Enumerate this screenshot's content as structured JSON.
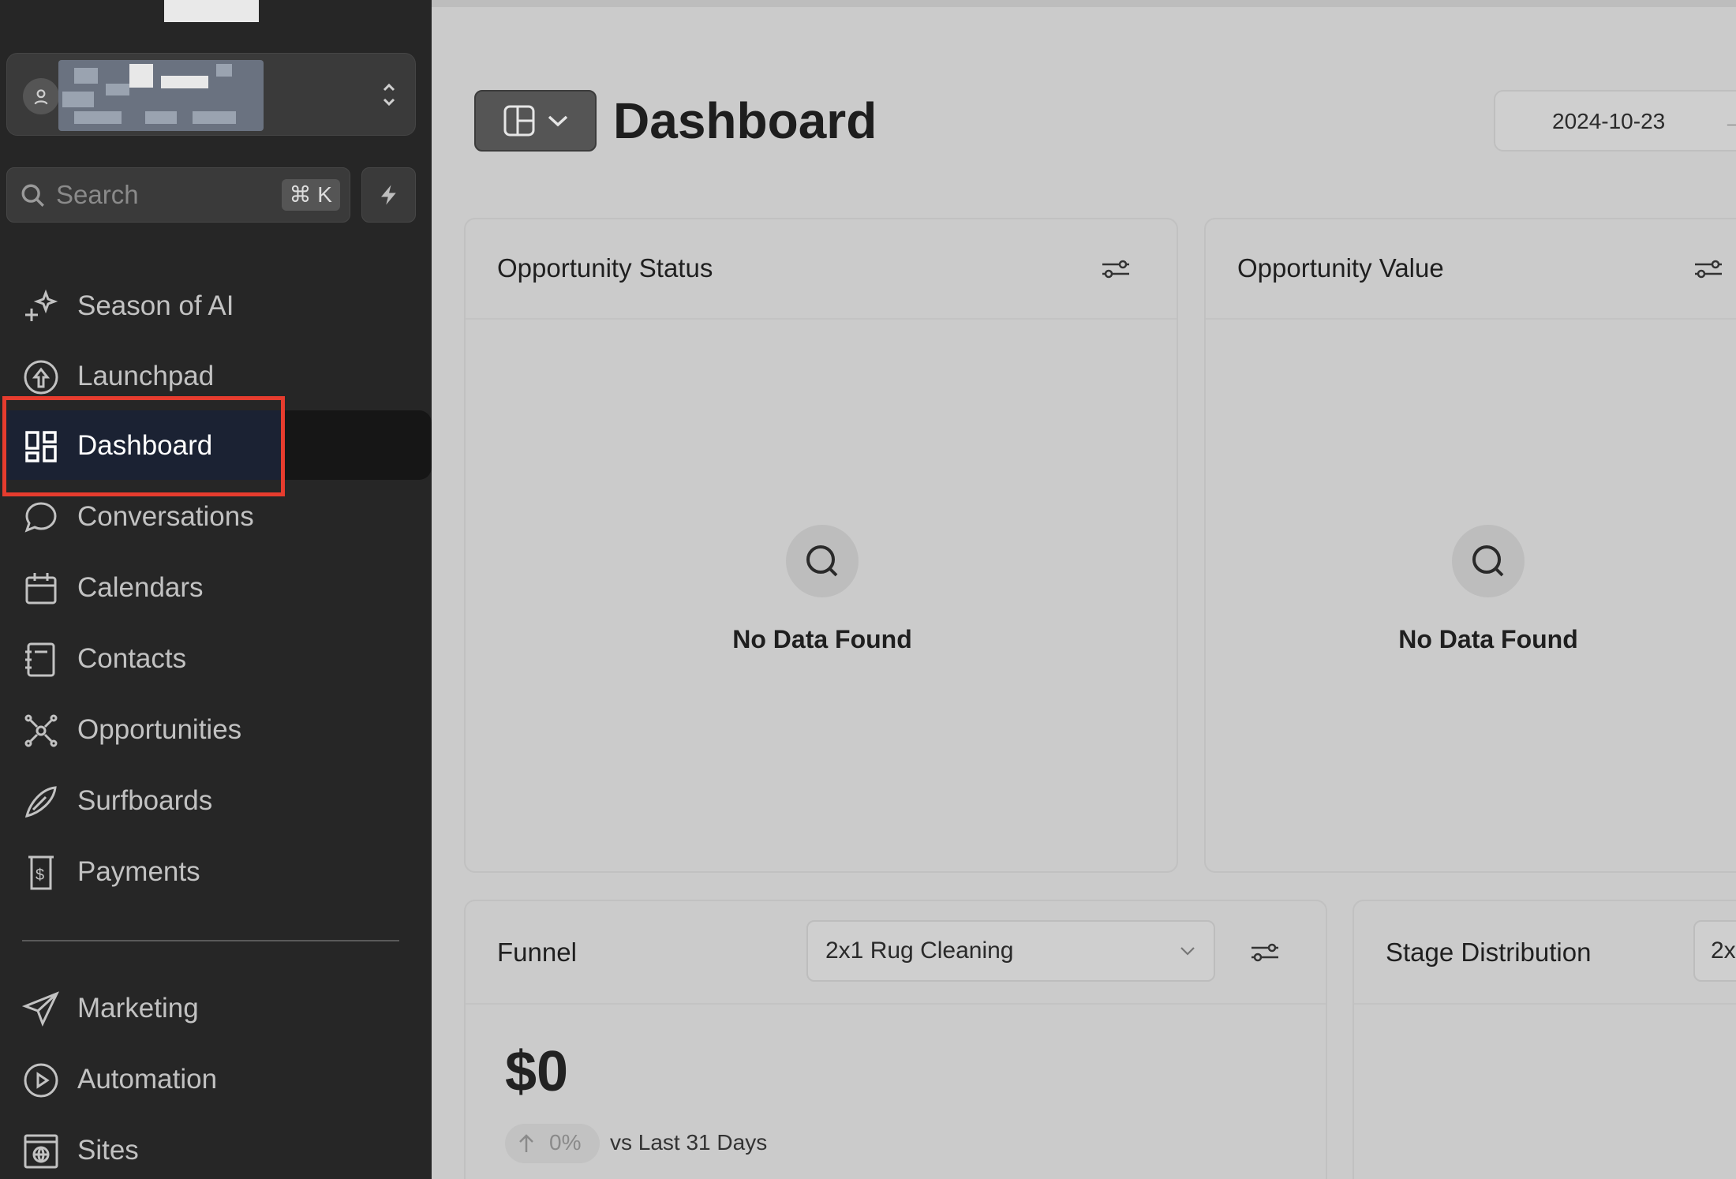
{
  "sidebar": {
    "search_placeholder": "Search",
    "search_shortcut": "⌘ K",
    "items": [
      {
        "label": "Season of AI",
        "icon": "sparkle-plus-icon"
      },
      {
        "label": "Launchpad",
        "icon": "rocket-up-icon"
      },
      {
        "label": "Dashboard",
        "icon": "grid-layout-icon",
        "active": true
      },
      {
        "label": "Conversations",
        "icon": "chat-bubble-icon"
      },
      {
        "label": "Calendars",
        "icon": "calendar-icon"
      },
      {
        "label": "Contacts",
        "icon": "contacts-book-icon"
      },
      {
        "label": "Opportunities",
        "icon": "network-icon"
      },
      {
        "label": "Surfboards",
        "icon": "surfboard-icon"
      },
      {
        "label": "Payments",
        "icon": "receipt-dollar-icon"
      }
    ],
    "items_secondary": [
      {
        "label": "Marketing",
        "icon": "send-icon"
      },
      {
        "label": "Automation",
        "icon": "play-circle-icon"
      },
      {
        "label": "Sites",
        "icon": "globe-page-icon"
      }
    ]
  },
  "header": {
    "title": "Dashboard",
    "date": "2024-10-23",
    "date_arrow": "→"
  },
  "cards": {
    "opportunity_status": {
      "title": "Opportunity Status",
      "empty": "No Data Found"
    },
    "opportunity_value": {
      "title": "Opportunity Value",
      "empty": "No Data Found"
    },
    "funnel": {
      "title": "Funnel",
      "pipeline": "2x1 Rug Cleaning",
      "value": "$0",
      "change": "0%",
      "comparison": "vs Last 31 Days"
    },
    "stage_distribution": {
      "title": "Stage Distribution",
      "pipeline": "2x"
    }
  },
  "colors": {
    "sidebar_bg": "#262626",
    "active_bg": "#1b2233",
    "highlight_box": "#e63c2e",
    "main_bg": "#cbcbcb"
  }
}
